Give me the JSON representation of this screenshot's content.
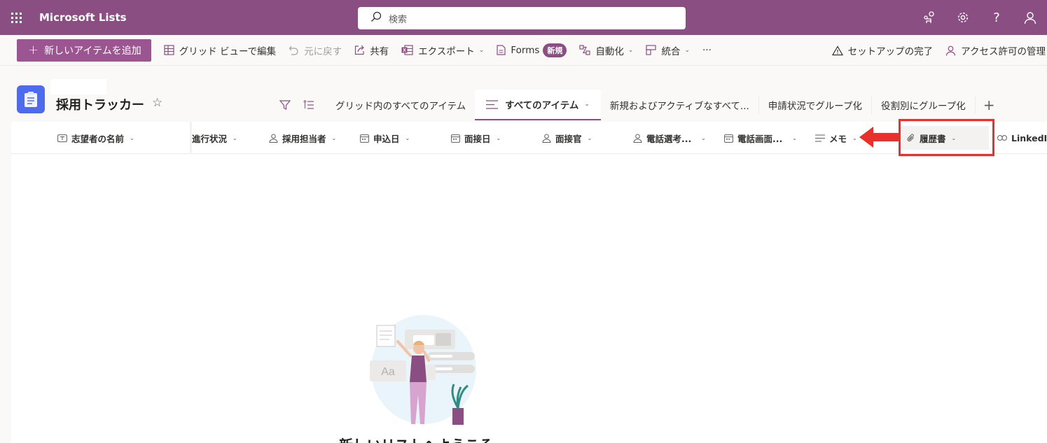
{
  "app": {
    "name": "Microsoft Lists"
  },
  "search": {
    "placeholder": "検索"
  },
  "topbar_icons": [
    "share-people-icon",
    "gear-icon",
    "help-icon",
    "person-icon"
  ],
  "commands": {
    "new_item": "新しいアイテムを追加",
    "edit_grid": "グリッド ビューで編集",
    "undo": "元に戻す",
    "share": "共有",
    "export": "エクスポート",
    "forms": "Forms",
    "forms_badge": "新規",
    "automate": "自動化",
    "integrate": "統合",
    "more": "···",
    "setup": "セットアップの完了",
    "access": "アクセス許可の管理"
  },
  "list": {
    "title": "採用トラッカー"
  },
  "views": {
    "tabs": [
      "グリッド内のすべてのアイテム",
      "すべてのアイテム",
      "新規およびアクティブなすべて...",
      "申請状況でグループ化",
      "役割別にグループ化"
    ],
    "active_index": 1,
    "add": "+"
  },
  "columns": [
    {
      "label": "志望者の名前",
      "icon": "text-field-icon"
    },
    {
      "label": "進行状況",
      "icon": ""
    },
    {
      "label": "採用担当者",
      "icon": "person-icon"
    },
    {
      "label": "申込日",
      "icon": "calendar-icon"
    },
    {
      "label": "面接日",
      "icon": "calendar-icon"
    },
    {
      "label": "面接官",
      "icon": "person-icon"
    },
    {
      "label": "電話選考...",
      "icon": "person-icon"
    },
    {
      "label": "電話画面...",
      "icon": "calendar-icon"
    },
    {
      "label": "メモ",
      "icon": "multiline-text-icon"
    },
    {
      "label": "履歴書",
      "icon": "paperclip-icon"
    },
    {
      "label": "LinkedIn",
      "icon": "link-icon"
    }
  ],
  "empty_state": {
    "message": "新しいリストへようこそ"
  },
  "annotation": {
    "highlight_color": "#e8302c"
  },
  "colors": {
    "brand": "#8b4e82",
    "new_button": "#9b5591",
    "list_icon": "#4f6bed"
  }
}
